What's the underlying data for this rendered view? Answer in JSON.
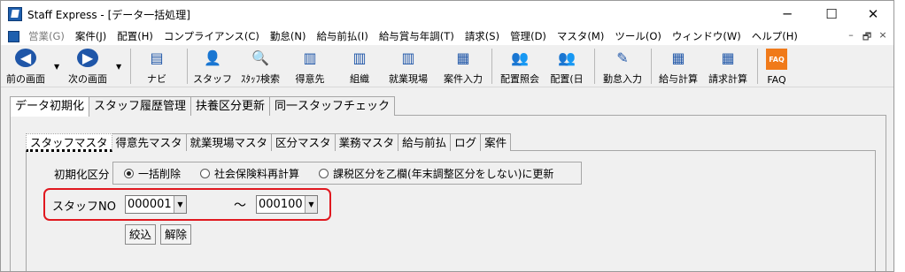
{
  "window": {
    "title": "Staff Express - [データ一括処理]"
  },
  "controls": {
    "minimize": "─",
    "maximize": "☐",
    "close": "✕",
    "mdi_min": "–",
    "mdi_restore": "🗗",
    "mdi_close": "×"
  },
  "menu": [
    {
      "label": "営業(G)",
      "enabled": false
    },
    {
      "label": "案件(J)",
      "enabled": true
    },
    {
      "label": "配置(H)",
      "enabled": true
    },
    {
      "label": "コンプライアンス(C)",
      "enabled": true
    },
    {
      "label": "勤怠(N)",
      "enabled": true
    },
    {
      "label": "給与前払(I)",
      "enabled": true
    },
    {
      "label": "給与賞与年調(T)",
      "enabled": true
    },
    {
      "label": "請求(S)",
      "enabled": true
    },
    {
      "label": "管理(D)",
      "enabled": true
    },
    {
      "label": "マスタ(M)",
      "enabled": true
    },
    {
      "label": "ツール(O)",
      "enabled": true
    },
    {
      "label": "ウィンドウ(W)",
      "enabled": true
    },
    {
      "label": "ヘルプ(H)",
      "enabled": true
    }
  ],
  "toolbar": {
    "prev": "前の画面",
    "next": "次の画面",
    "navi": "ナビ",
    "staff": "スタッフ",
    "staff_search": "ｽﾀｯﾌ検索",
    "client": "得意先",
    "org": "組織",
    "site": "就業現場",
    "job_input": "案件入力",
    "assign_view": "配置照会",
    "assign_day": "配置(日",
    "attendance_input": "勤怠入力",
    "payroll_calc": "給与計算",
    "billing_calc": "請求計算",
    "faq": "FAQ",
    "faq_icon_text": "FAQ"
  },
  "outer_tabs": [
    "データ初期化",
    "スタッフ履歴管理",
    "扶養区分更新",
    "同一スタッフチェック"
  ],
  "inner_tabs": [
    "スタッフマスタ",
    "得意先マスタ",
    "就業現場マスタ",
    "区分マスタ",
    "業務マスタ",
    "給与前払",
    "ログ",
    "案件"
  ],
  "init": {
    "label": "初期化区分",
    "options": [
      "一括削除",
      "社会保険料再計算",
      "課税区分を乙欄(年末調整区分をしない)に更新"
    ],
    "selected": 0
  },
  "range": {
    "label": "スタッフNO",
    "from": "000001",
    "tilde": "～",
    "to": "000100"
  },
  "buttons": {
    "filter": "絞込",
    "clear": "解除"
  },
  "colors": {
    "highlight": "#e0181f",
    "icon_blue": "#1f56a8"
  }
}
